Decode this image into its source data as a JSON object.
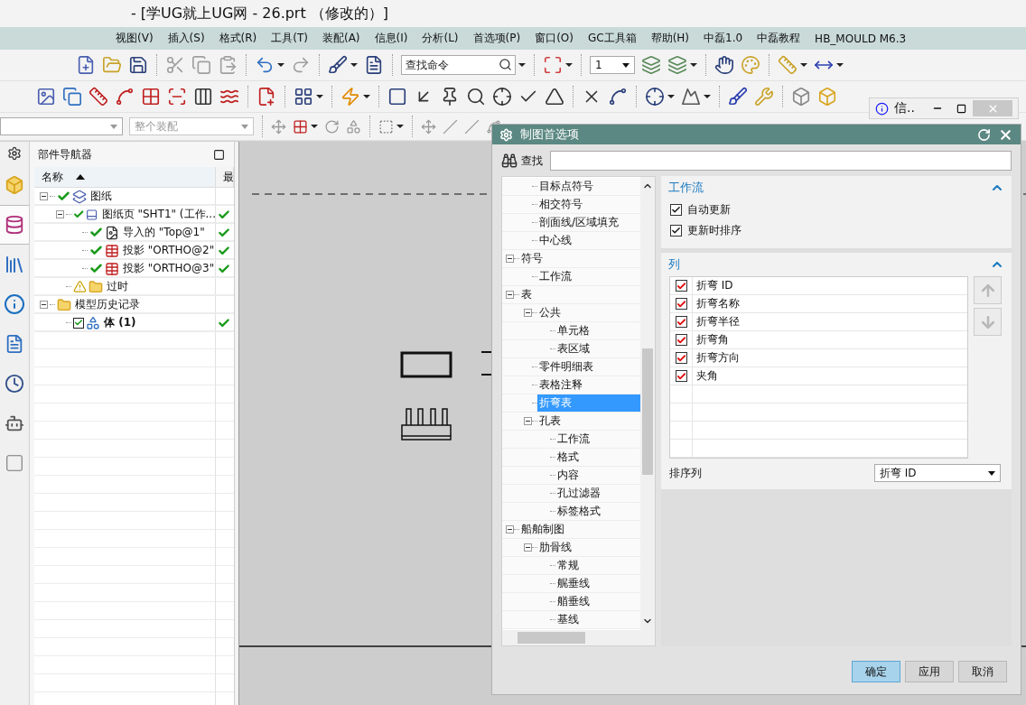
{
  "window": {
    "title": "- [学UG就上UG网 - 26.prt （修改的）]"
  },
  "menu": [
    "视图(V)",
    "插入(S)",
    "格式(R)",
    "工具(T)",
    "装配(A)",
    "信息(I)",
    "分析(L)",
    "首选项(P)",
    "窗口(O)",
    "GC工具箱",
    "帮助(H)",
    "中磊1.0",
    "中磊教程",
    "HB_MOULD M6.3"
  ],
  "toolbar": {
    "command_search": {
      "placeholder": "查找命令"
    },
    "layer": {
      "value": "1"
    },
    "assembly_scope": {
      "value": "整个装配",
      "disabled": true
    }
  },
  "resource_tabs": [
    {
      "kind": "assembly",
      "selected": false
    },
    {
      "kind": "part",
      "selected": true
    },
    {
      "kind": "library",
      "selected": false
    },
    {
      "kind": "info",
      "selected": false
    },
    {
      "kind": "document",
      "selected": false
    },
    {
      "kind": "history",
      "selected": false
    },
    {
      "kind": "robot",
      "selected": false
    },
    {
      "kind": "blank",
      "selected": false
    }
  ],
  "navigator": {
    "title": "部件导航器",
    "columns": [
      {
        "label": "名称",
        "sorted": true
      },
      {
        "label": "最"
      }
    ],
    "nodes": [
      {
        "label": "图纸",
        "kind": "drawing",
        "checked": true,
        "up_to_date": false,
        "active": false,
        "expanded": true,
        "children": [
          {
            "label": "图纸页 \"SHT1\" (工作...",
            "kind": "sheet",
            "checked": true,
            "up_to_date": true,
            "active": false,
            "expanded": true,
            "children": [
              {
                "label": "导入的 \"Top@1\"",
                "kind": "view",
                "checked": true,
                "up_to_date": true,
                "active": false
              },
              {
                "label": "投影 \"ORTHO@2\"",
                "kind": "projection",
                "checked": true,
                "up_to_date": true,
                "active": false
              },
              {
                "label": "投影 \"ORTHO@3\"",
                "kind": "projection",
                "checked": true,
                "up_to_date": true,
                "active": false
              }
            ]
          },
          {
            "label": "过时",
            "kind": "outdated",
            "checked": false,
            "up_to_date": false,
            "active": false
          }
        ]
      },
      {
        "label": "模型历史记录",
        "kind": "history",
        "checked": false,
        "up_to_date": false,
        "active": false,
        "expanded": true,
        "children": [
          {
            "label": "体 (1)",
            "kind": "body",
            "checked": true,
            "up_to_date": true,
            "active": true
          }
        ]
      }
    ]
  },
  "info_window": {
    "title": "信.."
  },
  "dialog": {
    "title": "制图首选项",
    "search": {
      "label": "查找"
    },
    "tree": {
      "continued": [
        {
          "label": "目标点符号",
          "selected": false
        },
        {
          "label": "相交符号",
          "selected": false
        },
        {
          "label": "剖面线/区域填充",
          "selected": false
        },
        {
          "label": "中心线",
          "selected": false
        }
      ],
      "items": [
        {
          "label": "符号",
          "selected": false,
          "expanded": true,
          "children": [
            {
              "label": "工作流",
              "selected": false
            }
          ]
        },
        {
          "label": "表",
          "selected": false,
          "expanded": true,
          "children": [
            {
              "label": "公共",
              "selected": false,
              "expanded": true,
              "children": [
                {
                  "label": "单元格",
                  "selected": false
                },
                {
                  "label": "表区域",
                  "selected": false
                }
              ]
            },
            {
              "label": "零件明细表",
              "selected": false
            },
            {
              "label": "表格注释",
              "selected": false
            },
            {
              "label": "折弯表",
              "selected": true
            },
            {
              "label": "孔表",
              "selected": false,
              "expanded": true,
              "children": [
                {
                  "label": "工作流",
                  "selected": false
                },
                {
                  "label": "格式",
                  "selected": false
                },
                {
                  "label": "内容",
                  "selected": false
                },
                {
                  "label": "孔过滤器",
                  "selected": false
                },
                {
                  "label": "标签格式",
                  "selected": false
                }
              ]
            }
          ]
        },
        {
          "label": "船舶制图",
          "selected": false,
          "expanded": true,
          "children": [
            {
              "label": "肋骨线",
              "selected": false,
              "expanded": true,
              "children": [
                {
                  "label": "常规",
                  "selected": false
                },
                {
                  "label": "艉垂线",
                  "selected": false
                },
                {
                  "label": "艏垂线",
                  "selected": false
                },
                {
                  "label": "基线",
                  "selected": false
                }
              ]
            }
          ]
        }
      ]
    },
    "sections": [
      {
        "title": "工作流",
        "kind": "options",
        "expanded": true,
        "options": [
          {
            "label": "自动更新",
            "checked": true
          },
          {
            "label": "更新时排序",
            "checked": true
          }
        ]
      },
      {
        "title": "列",
        "kind": "columns",
        "expanded": true,
        "rows": [
          {
            "label": "折弯 ID",
            "checked": true
          },
          {
            "label": "折弯名称",
            "checked": true
          },
          {
            "label": "折弯半径",
            "checked": true
          },
          {
            "label": "折弯角",
            "checked": true
          },
          {
            "label": "折弯方向",
            "checked": true
          },
          {
            "label": "夹角",
            "checked": true
          }
        ],
        "sort": {
          "label": "排序列",
          "value": "折弯 ID"
        }
      }
    ],
    "buttons": [
      {
        "label": "确定",
        "default": true
      },
      {
        "label": "应用",
        "default": false
      },
      {
        "label": "取消",
        "default": false
      }
    ]
  }
}
